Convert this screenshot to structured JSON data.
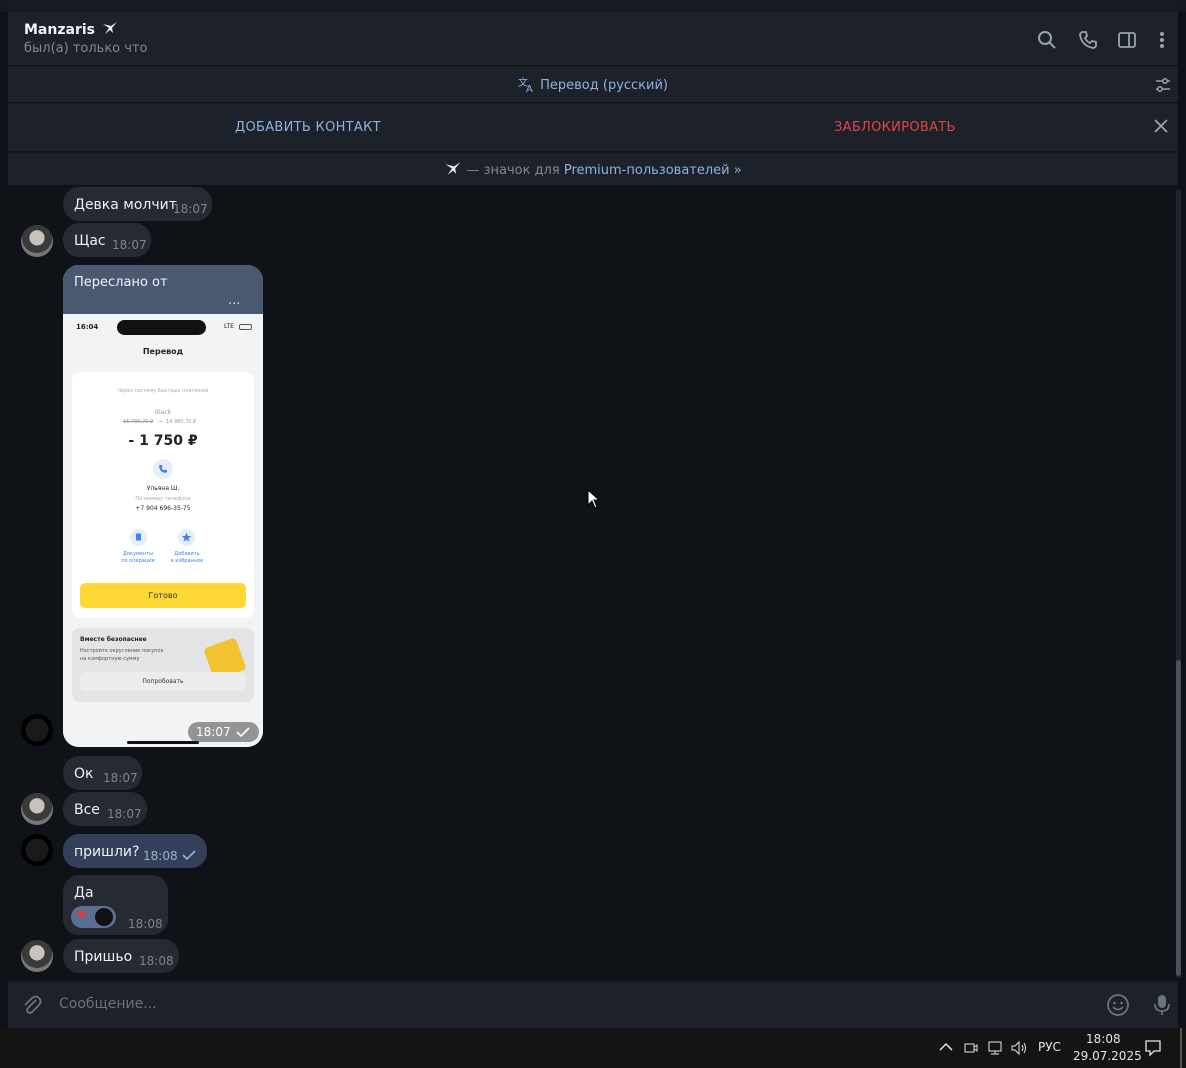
{
  "header": {
    "name": "Manzaris",
    "status": "был(а) только что"
  },
  "translate_bar": {
    "label": "Перевод (русский)"
  },
  "action_bar": {
    "add_contact": "ДОБАВИТЬ КОНТАКТ",
    "block": "ЗАБЛОКИРОВАТЬ"
  },
  "premium_bar": {
    "text": "— значок для ",
    "link": "Premium-пользователей »"
  },
  "messages": [
    {
      "text": "Девка молчит",
      "time": "18:07"
    },
    {
      "text": "Щас",
      "time": "18:07"
    },
    {
      "text": "Ок",
      "time": "18:07"
    },
    {
      "text": "Все",
      "time": "18:07"
    },
    {
      "text": "пришли?",
      "time": "18:08"
    },
    {
      "text": "Да",
      "time": "18:08"
    },
    {
      "text": "Пришьо",
      "time": "18:08"
    }
  ],
  "forwarded": {
    "label": "Переслано от",
    "dots": "...",
    "time": "18:07",
    "screenshot": {
      "status_time": "16:04",
      "network": "LTE",
      "title": "Перевод",
      "sbp": "Через систему быстрых платежей",
      "card_name": "Black",
      "balance_from": "16 730,70 ₽",
      "balance_to": "14 980,70 ₽",
      "amount": "- 1 750 ₽",
      "recipient": "Ульяна Ш.",
      "by_phone": "По номеру телефона",
      "phone": "+7 904 696-35-75",
      "docs_line1": "Документы",
      "docs_line2": "по операции",
      "fav_line1": "Добавить",
      "fav_line2": "в избранное",
      "done": "Готово",
      "promo_title": "Вместе безопаснее",
      "promo_line1": "Настройте округление покупок",
      "promo_line2": "на комфортную сумму",
      "promo_button": "Попробовать"
    }
  },
  "composer": {
    "placeholder": "Сообщение..."
  },
  "taskbar": {
    "lang": "РУС",
    "time": "18:08",
    "date": "29.07.2025"
  }
}
